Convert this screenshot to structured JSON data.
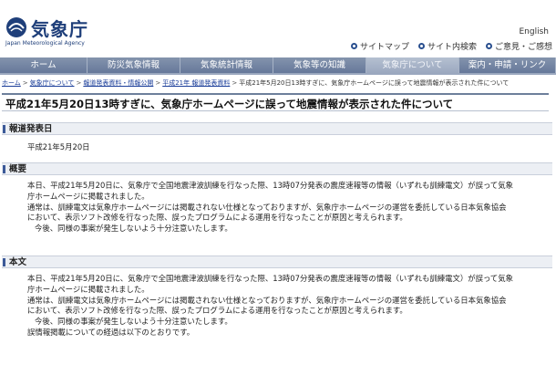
{
  "header": {
    "logo_ja": "気象庁",
    "logo_en": "Japan Meteorological Agency",
    "english_label": "English",
    "util_links": [
      "サイトマップ",
      "サイト内検索",
      "ご意見・ご感想"
    ]
  },
  "nav": {
    "tabs": [
      {
        "label": "ホーム",
        "active": false
      },
      {
        "label": "防災気象情報",
        "active": false
      },
      {
        "label": "気象統計情報",
        "active": false
      },
      {
        "label": "気象等の知識",
        "active": false
      },
      {
        "label": "気象庁について",
        "active": true
      },
      {
        "label": "案内・申請・リンク",
        "active": false
      }
    ]
  },
  "breadcrumb": {
    "links": [
      "ホーム",
      "気象庁について",
      "報道発表資料・情報公開",
      "平成21年 報道発表資料"
    ],
    "current": "平成21年5月20日13時すぎに、気象庁ホームページに誤って地震情報が表示された件について"
  },
  "page_title": "平成21年5月20日13時すぎに、気象庁ホームページに誤って地震情報が表示された件について",
  "sections": {
    "date": {
      "heading": "報道発表日",
      "text": "平成21年5月20日"
    },
    "summary": {
      "heading": "概要",
      "lines": [
        "本日、平成21年5月20日に、気象庁で全国地震津波訓練を行なった際、13時07分発表の震度速報等の情報（いずれも訓練電文）が誤って気象",
        "庁ホームページに掲載されました。",
        "通常は、訓練電文は気象庁ホームページには掲載されない仕様となっておりますが、気象庁ホームページの運営を委託している日本気象協会",
        "において、表示ソフト改修を行なった際、誤ったプログラムによる運用を行なったことが原因と考えられます。",
        "今後、同様の事案が発生しないよう十分注意いたします。"
      ]
    },
    "body": {
      "heading": "本文",
      "lines": [
        "本日、平成21年5月20日に、気象庁で全国地震津波訓練を行なった際、13時07分発表の震度速報等の情報（いずれも訓練電文）が誤って気象",
        "庁ホームページに掲載されました。",
        "通常は、訓練電文は気象庁ホームページには掲載されない仕様となっておりますが、気象庁ホームページの運営を委託している日本気象協会",
        "において、表示ソフト改修を行なった際、誤ったプログラムによる運用を行なったことが原因と考えられます。",
        "今後、同様の事案が発生しないよう十分注意いたします。",
        "誤情報掲載についての経過は以下のとおりです。"
      ]
    }
  },
  "colors": {
    "nav_bg": "#6d7f9b",
    "nav_active": "#9ba8bf",
    "link": "#1a3d99",
    "logo": "#1f3f7a"
  },
  "icons": {
    "logo": "jma-logo-icon",
    "util": "bullet-circle-icon"
  }
}
